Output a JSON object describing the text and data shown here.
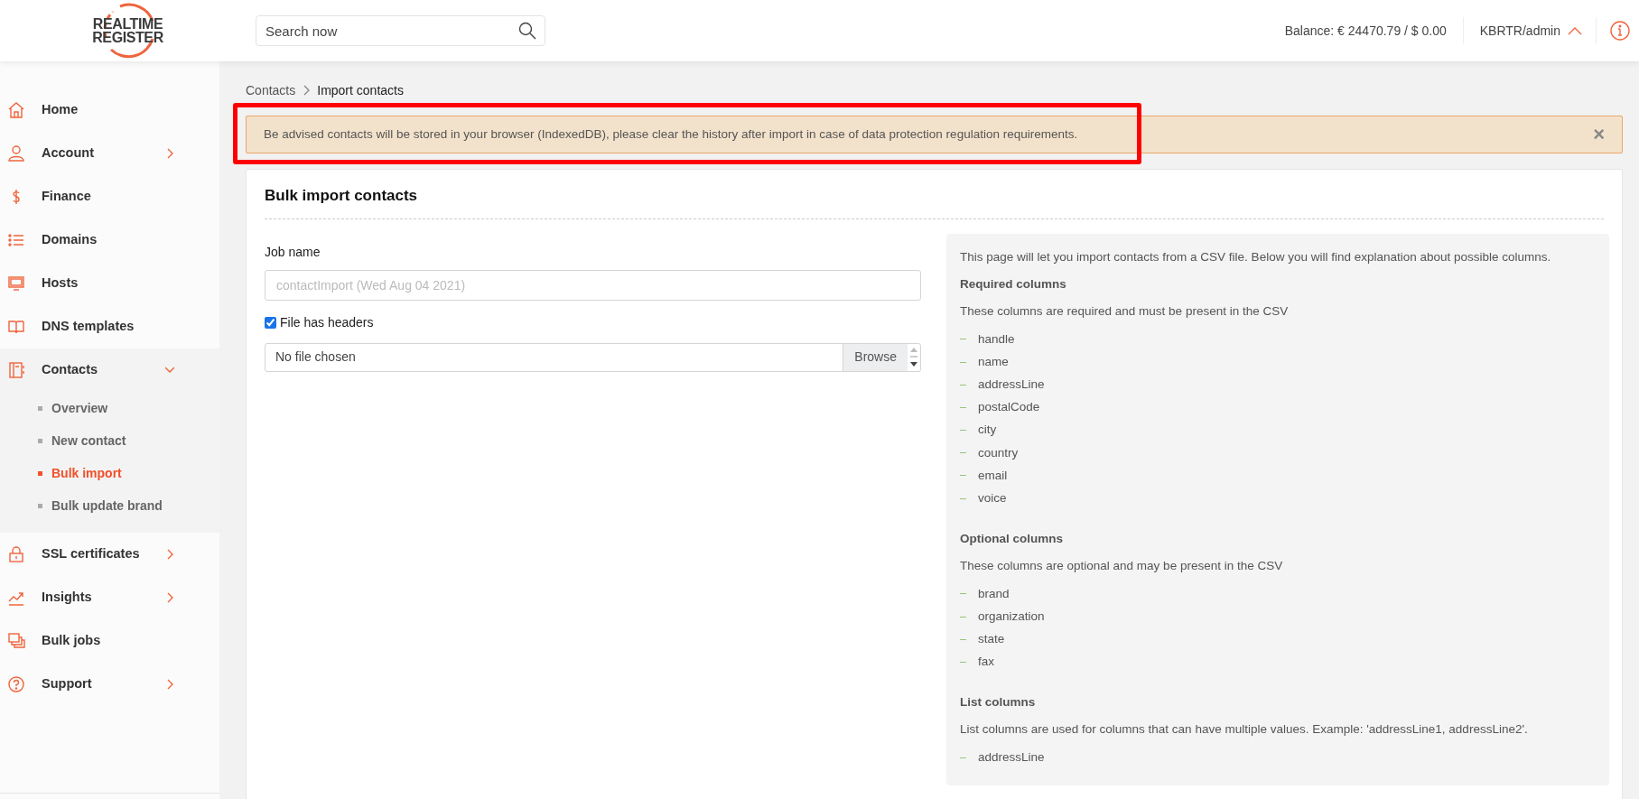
{
  "header": {
    "logo": [
      "REALTIME",
      "REGISTER"
    ],
    "search": {
      "placeholder": "Search now"
    },
    "balance": "Balance: € 24470.79 / $ 0.00",
    "user": "KBRTR/admin",
    "user_menu_expanded": true
  },
  "sidebar": {
    "items": [
      {
        "label": "Home",
        "expandable": false
      },
      {
        "label": "Account",
        "expandable": true,
        "expanded": false
      },
      {
        "label": "Finance",
        "expandable": false
      },
      {
        "label": "Domains",
        "expandable": false
      },
      {
        "label": "Hosts",
        "expandable": false
      },
      {
        "label": "DNS templates",
        "expandable": false
      },
      {
        "label": "Contacts",
        "expandable": true,
        "expanded": true,
        "children": [
          {
            "label": "Overview",
            "selected": false
          },
          {
            "label": "New contact",
            "selected": false
          },
          {
            "label": "Bulk import",
            "selected": true
          },
          {
            "label": "Bulk update brand",
            "selected": false
          }
        ]
      },
      {
        "label": "SSL certificates",
        "expandable": true,
        "expanded": false
      },
      {
        "label": "Insights",
        "expandable": true,
        "expanded": false
      },
      {
        "label": "Bulk jobs",
        "expandable": false
      },
      {
        "label": "Support",
        "expandable": true,
        "expanded": false
      }
    ]
  },
  "breadcrumb": [
    "Contacts",
    "Import contacts"
  ],
  "alert": {
    "text": "Be advised contacts will be stored in your browser (IndexedDB), please clear the history after import in case of data protection regulation requirements.",
    "close": "×",
    "highlighted": true
  },
  "card": {
    "title": "Bulk import contacts",
    "job_name": {
      "label": "Job name",
      "placeholder": "contactImport (Wed Aug 04 2021)"
    },
    "headers_checkbox": {
      "label": "File has headers",
      "checked": true
    },
    "file": {
      "value": "No file chosen",
      "button": "Browse"
    },
    "info": {
      "intro": "This page will let you import contacts from a CSV file. Below you will find explanation about possible columns.",
      "sections": [
        {
          "heading": "Required columns",
          "text": "These columns are required and must be present in the CSV",
          "items": [
            "handle",
            "name",
            "addressLine",
            "postalCode",
            "city",
            "country",
            "email",
            "voice"
          ]
        },
        {
          "heading": "Optional columns",
          "text": "These columns are optional and may be present in the CSV",
          "items": [
            "brand",
            "organization",
            "state",
            "fax"
          ]
        },
        {
          "heading": "List columns",
          "text": "List columns are used for columns that can have multiple values. Example: 'addressLine1, addressLine2'.",
          "items": [
            "addressLine"
          ]
        }
      ]
    }
  }
}
